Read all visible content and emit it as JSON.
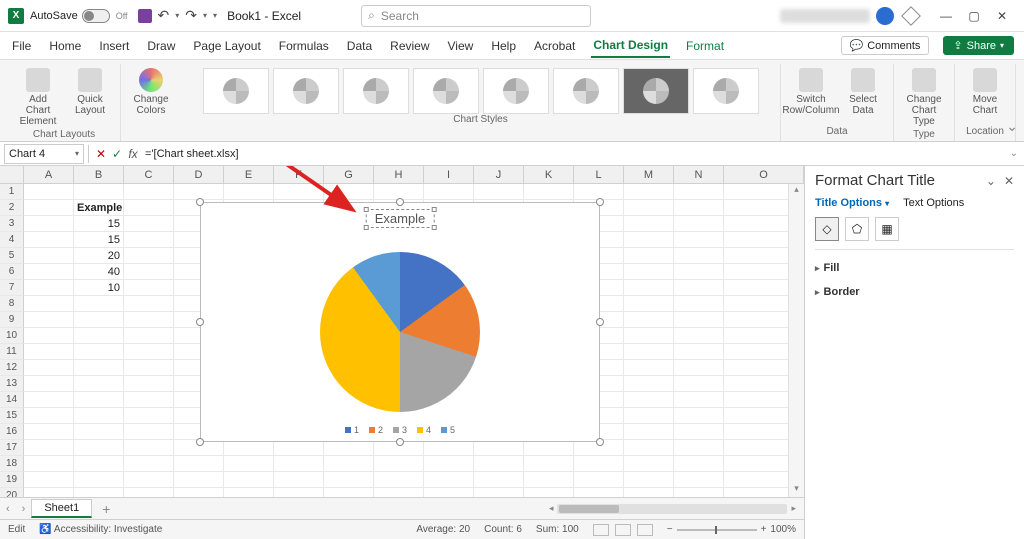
{
  "titlebar": {
    "autosave_label": "AutoSave",
    "autosave_state": "Off",
    "doc_title": "Book1 - Excel",
    "search_placeholder": "Search"
  },
  "menu": {
    "tabs": [
      "File",
      "Home",
      "Insert",
      "Draw",
      "Page Layout",
      "Formulas",
      "Data",
      "Review",
      "View",
      "Help",
      "Acrobat",
      "Chart Design",
      "Format"
    ],
    "active": "Chart Design",
    "comments": "Comments",
    "share": "Share"
  },
  "ribbon": {
    "layouts": {
      "add_chart_element": "Add Chart Element",
      "quick_layout": "Quick Layout",
      "change_colors": "Change Colors",
      "group": "Chart Layouts"
    },
    "styles_group": "Chart Styles",
    "data": {
      "switch": "Switch Row/Column",
      "select": "Select Data",
      "group": "Data"
    },
    "type": {
      "change": "Change Chart Type",
      "group": "Type"
    },
    "location": {
      "move": "Move Chart",
      "group": "Location"
    }
  },
  "formula_bar": {
    "name_box": "Chart 4",
    "formula": "='[Chart sheet.xlsx]"
  },
  "grid": {
    "cols": [
      "A",
      "B",
      "C",
      "D",
      "E",
      "F",
      "G",
      "H",
      "I",
      "J",
      "K",
      "L",
      "M",
      "N",
      "O"
    ],
    "rows": 20,
    "b2": "Example",
    "b3": "15",
    "b4": "15",
    "b5": "20",
    "b6": "40",
    "b7": "10"
  },
  "chart_data": {
    "type": "pie",
    "title": "Example",
    "categories": [
      "1",
      "2",
      "3",
      "4",
      "5"
    ],
    "values": [
      15,
      15,
      20,
      40,
      10
    ],
    "colors": [
      "#4472c4",
      "#ed7d31",
      "#a5a5a5",
      "#ffc000",
      "#5b9bd5"
    ]
  },
  "format_pane": {
    "title": "Format Chart Title",
    "title_options": "Title Options",
    "text_options": "Text Options",
    "fill": "Fill",
    "border": "Border"
  },
  "sheet_tabs": {
    "active": "Sheet1"
  },
  "statusbar": {
    "mode": "Edit",
    "accessibility": "Accessibility: Investigate",
    "average": "Average: 20",
    "count": "Count: 6",
    "sum": "Sum: 100",
    "zoom": "100%"
  }
}
